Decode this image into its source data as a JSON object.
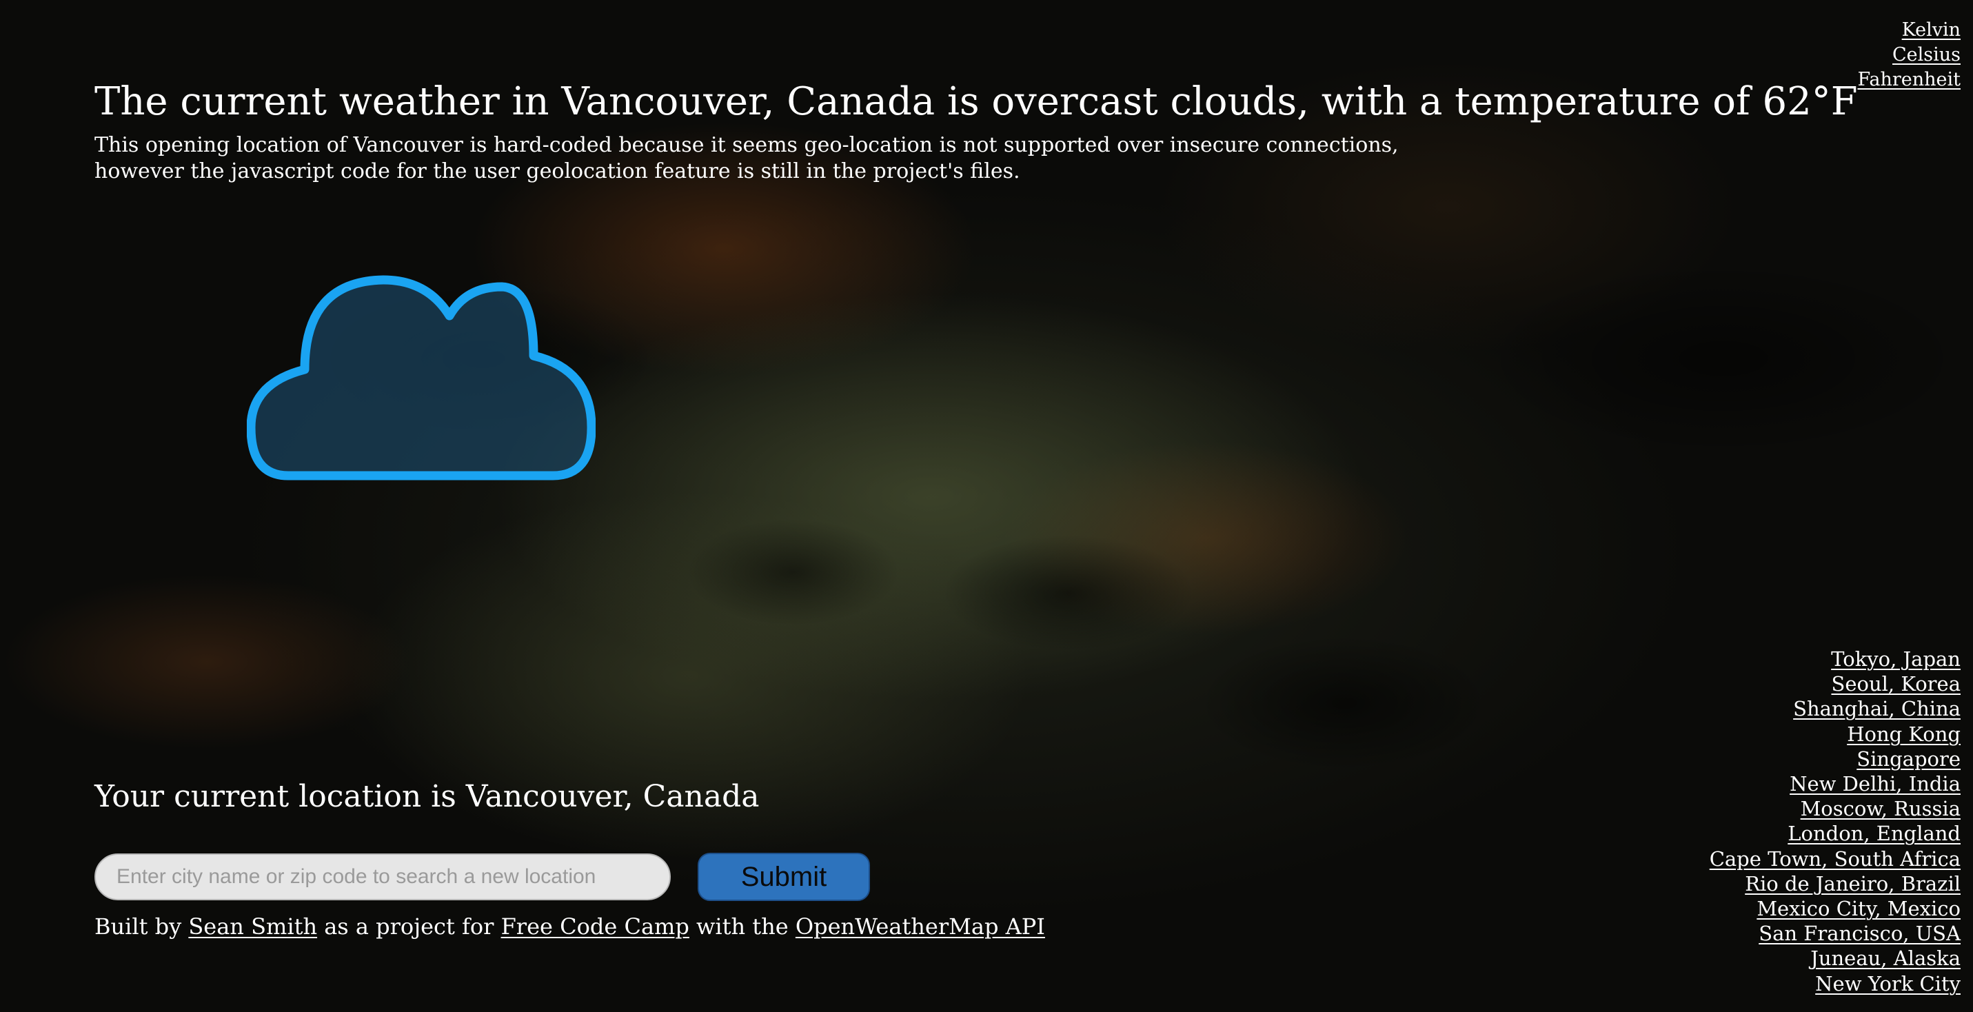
{
  "units": [
    "Kelvin",
    "Celsius",
    "Fahrenheit"
  ],
  "headline": "The current weather in Vancouver, Canada is overcast clouds, with a temperature of 62°F",
  "note_line1": "This opening location of Vancouver is hard-coded because it seems geo-location is not supported over insecure connections,",
  "note_line2": "however the javascript code for the user geolocation feature is still in the project's files.",
  "weather_icon": "cloud-icon",
  "location_text": "Your current location is Vancouver, Canada",
  "search": {
    "placeholder": "Enter city name or zip code to search a new location",
    "value": ""
  },
  "submit_label": "Submit",
  "credits": {
    "prefix": "Built by",
    "author": "Sean Smith",
    "middle": "as a project for",
    "org": "Free Code Camp",
    "with": "with the",
    "api": "OpenWeatherMap API"
  },
  "cities": [
    "Tokyo, Japan",
    "Seoul, Korea",
    "Shanghai, China",
    "Hong Kong",
    "Singapore",
    "New Delhi, India",
    "Moscow, Russia",
    "London, England",
    "Cape Town, South Africa",
    "Rio de Janeiro, Brazil",
    "Mexico City, Mexico",
    "San Francisco, USA",
    "Juneau, Alaska",
    "New York City"
  ],
  "colors": {
    "cloud_stroke": "#1aa4f2",
    "cloud_fill": "#1c4a68",
    "submit_bg": "#2d73bd",
    "input_bg": "#e6e6e6"
  }
}
